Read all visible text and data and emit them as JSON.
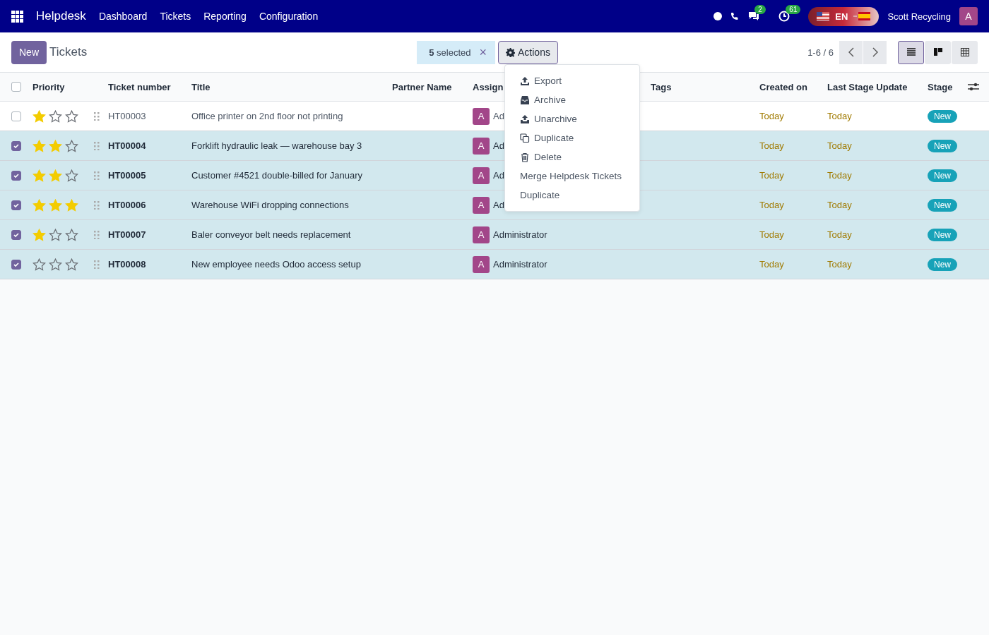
{
  "navbar": {
    "app_name": "Helpdesk",
    "menu": [
      "Dashboard",
      "Tickets",
      "Reporting",
      "Configuration"
    ],
    "chat_count": "2",
    "activity_count": "61",
    "language": "EN",
    "company": "Scott Recycling",
    "avatar": "A"
  },
  "control_panel": {
    "new_button": "New",
    "breadcrumb": "Tickets",
    "selection": "**5** selected",
    "clear": "×",
    "actions_button": "Actions",
    "pager": "1-6 / 6",
    "views": [
      {
        "selected": true
      },
      {
        "selected": false
      },
      {
        "selected": false
      }
    ]
  },
  "actions_menu": [
    {
      "label": "Export",
      "kind": "icon"
    },
    {
      "label": "Archive",
      "kind": "icon"
    },
    {
      "label": "Unarchive",
      "kind": "icon"
    },
    {
      "label": "Duplicate",
      "kind": "icon"
    },
    {
      "label": "Delete",
      "kind": "icon"
    },
    {
      "label": "Merge Helpdesk Tickets",
      "kind": "plain"
    },
    {
      "label": "Duplicate",
      "kind": "plain"
    }
  ],
  "table": {
    "all_checked": false,
    "columns": [
      "Priority",
      "Ticket number",
      "Title",
      "Partner Name",
      "Assign",
      "Tags",
      "Created on",
      "Last Stage Update",
      "Stage"
    ],
    "rows": [
      {
        "selected": false,
        "stars": 1,
        "number": "HT00003",
        "title": "Office printer on 2nd floor not printing",
        "avatar": "A",
        "assignee": "Ad",
        "created": "Today",
        "updated": "Today",
        "stage": "New"
      },
      {
        "selected": true,
        "stars": 2,
        "number": "HT00004",
        "title": "Forklift hydraulic leak — warehouse bay 3",
        "avatar": "A",
        "assignee": "Ad",
        "created": "Today",
        "updated": "Today",
        "stage": "New"
      },
      {
        "selected": true,
        "stars": 2,
        "number": "HT00005",
        "title": "Customer #4521 double-billed for January",
        "avatar": "A",
        "assignee": "Ad",
        "created": "Today",
        "updated": "Today",
        "stage": "New"
      },
      {
        "selected": true,
        "stars": 3,
        "number": "HT00006",
        "title": "Warehouse WiFi dropping connections",
        "avatar": "A",
        "assignee": "Ad",
        "created": "Today",
        "updated": "Today",
        "stage": "New"
      },
      {
        "selected": true,
        "stars": 1,
        "number": "HT00007",
        "title": "Baler conveyor belt needs replacement",
        "avatar": "A",
        "assignee": "Administrator",
        "created": "Today",
        "updated": "Today",
        "stage": "New"
      },
      {
        "selected": true,
        "stars": 0,
        "number": "HT00008",
        "title": "New employee needs Odoo access setup",
        "avatar": "A",
        "assignee": "Administrator",
        "created": "Today",
        "updated": "Today",
        "stage": "New"
      }
    ]
  }
}
